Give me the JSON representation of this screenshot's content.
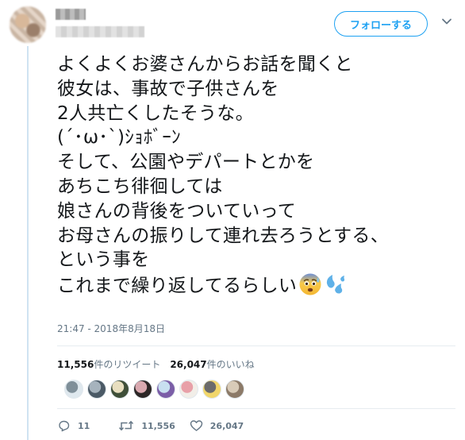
{
  "header": {
    "follow_label": "フォローする"
  },
  "tweet": {
    "lines": [
      "よくよくお婆さんからお話を聞くと",
      "彼女は、事故で子供さんを",
      "2人共亡くしたそうな。",
      "(´･ω･`)ｼｮﾎﾞｰﾝ",
      "そして、公園やデパートとかを",
      "あちこち徘徊しては",
      "娘さんの背後をついていって",
      "お母さんの振りして連れ去ろうとする、",
      "という事を",
      "これまで繰り返してるらしい"
    ],
    "emojis": [
      "anxious-face-with-sweat",
      "sweat-droplets"
    ],
    "timestamp": "21:47 - 2018年8月18日"
  },
  "stats": {
    "retweets_count": "11,556",
    "retweets_label": "件のリツイート",
    "likes_count": "26,047",
    "likes_label": "件のいいね"
  },
  "likers": [
    {
      "name": "liker-avatar-1",
      "colors": [
        "#dfe8ee",
        "#7f8f99"
      ]
    },
    {
      "name": "liker-avatar-2",
      "colors": [
        "#4b5a66",
        "#a6b3bd"
      ]
    },
    {
      "name": "liker-avatar-3",
      "colors": [
        "#3f4f38",
        "#e8dfc0"
      ]
    },
    {
      "name": "liker-avatar-4",
      "colors": [
        "#2c2626",
        "#d9a9b0"
      ]
    },
    {
      "name": "liker-avatar-5",
      "colors": [
        "#7b5ea7",
        "#c8e0f0"
      ]
    },
    {
      "name": "liker-avatar-6",
      "colors": [
        "#f2eee8",
        "#e8a0a8"
      ]
    },
    {
      "name": "liker-avatar-7",
      "colors": [
        "#f1d66a",
        "#6b6b6b"
      ]
    },
    {
      "name": "liker-avatar-8",
      "colors": [
        "#8c7a68",
        "#d8cbb8"
      ]
    }
  ],
  "actions": {
    "reply_count": "11",
    "retweet_count": "11,556",
    "like_count": "26,047"
  },
  "colors": {
    "accent": "#1da1f2",
    "text": "#14171a",
    "secondary": "#657786",
    "divider": "#e6ecf0"
  }
}
